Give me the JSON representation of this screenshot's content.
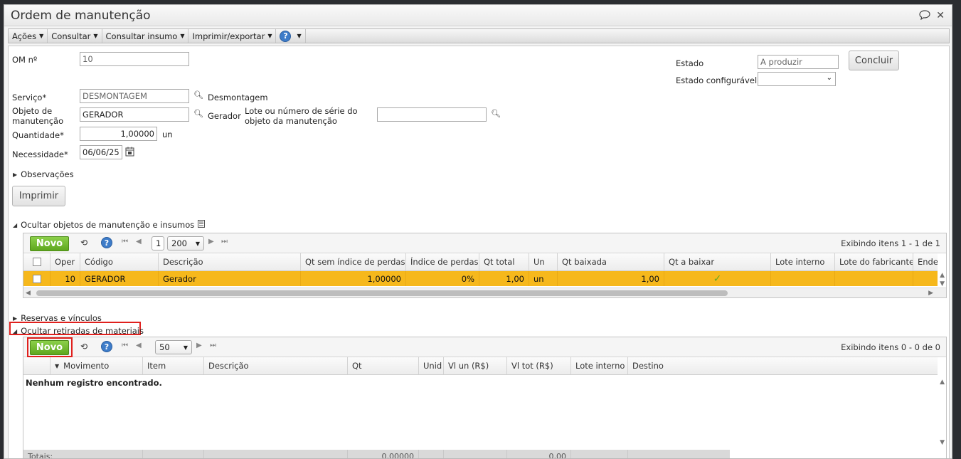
{
  "window": {
    "title": "Ordem de manutenção"
  },
  "menubar": {
    "items": [
      "Ações",
      "Consultar",
      "Consultar insumo",
      "Imprimir/exportar"
    ],
    "help": "?"
  },
  "form": {
    "om_label": "OM nº",
    "om_value": "10",
    "servico_label": "Serviço*",
    "servico_value": "DESMONTAGEM",
    "servico_desc": "Desmontagem",
    "objeto_label_1": "Objeto de",
    "objeto_label_2": "manutenção",
    "objeto_value": "GERADOR",
    "objeto_desc": "Gerador",
    "lote_label_1": "Lote ou número de série do",
    "lote_label_2": "objeto da manutenção",
    "lote_value": "",
    "quantidade_label": "Quantidade*",
    "quantidade_value": "1,00000",
    "quantidade_unit": "un",
    "necessidade_label": "Necessidade*",
    "necessidade_value": "06/06/25",
    "estado_label": "Estado",
    "estado_value": "A produzir",
    "estado_conf_label": "Estado configurável",
    "estado_conf_value": "",
    "concluir_label": "Concluir",
    "observacoes_label": "Observações",
    "imprimir_label": "Imprimir"
  },
  "objetos_section": {
    "toggle_label": "Ocultar objetos de manutenção e insumos",
    "novo_label": "Novo",
    "page_value": "1",
    "page_size": "200",
    "showing": "Exibindo itens 1 - 1 de 1",
    "columns": [
      "Oper",
      "Código",
      "Descrição",
      "Qt sem índice de perdas",
      "Índice de perdas",
      "Qt total",
      "Un",
      "Qt baixada",
      "Qt a baixar",
      "Lote interno",
      "Lote do fabricante",
      "Ende"
    ],
    "rows": [
      {
        "oper": "10",
        "codigo": "GERADOR",
        "descricao": "Gerador",
        "qt_sem": "1,00000",
        "indice": "0%",
        "qt_total": "1,00",
        "un": "un",
        "qt_baixada": "1,00",
        "qt_a_baixar": "✓",
        "lote_interno": "",
        "lote_fab": "",
        "ende": ""
      }
    ]
  },
  "reservas_label": "Reservas e vínculos",
  "retiradas_section": {
    "toggle_label": "Ocultar retiradas de materiais",
    "novo_label": "Novo",
    "page_size": "50",
    "showing": "Exibindo itens 0 - 0 de 0",
    "columns": [
      "Movimento",
      "Item",
      "Descrição",
      "Qt",
      "Unid",
      "Vl un (R$)",
      "Vl tot (R$)",
      "Lote interno",
      "Destino"
    ],
    "empty_message": "Nenhum registro encontrado.",
    "totals_label": "Totais:",
    "total_qt": "0,00000",
    "total_vl": "0,00"
  }
}
